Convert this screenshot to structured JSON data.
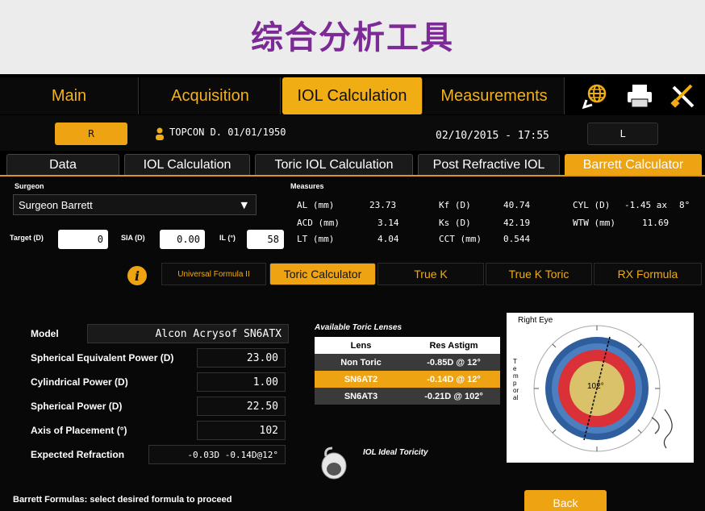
{
  "banner": {
    "title": "综合分析工具"
  },
  "main_tabs": [
    {
      "label": "Main"
    },
    {
      "label": "Acquisition"
    },
    {
      "label": "IOL Calculation"
    },
    {
      "label": "Measurements"
    }
  ],
  "icons": {
    "globe": "globe-icon",
    "printer": "printer-icon",
    "tools": "tools-icon"
  },
  "patient": {
    "right_eye": "R",
    "left_eye": "L",
    "name_dob": "TOPCON D. 01/01/1950",
    "datetime": "02/10/2015 - 17:55"
  },
  "sub_tabs": [
    {
      "label": "Data"
    },
    {
      "label": "IOL Calculation"
    },
    {
      "label": "Toric IOL Calculation"
    },
    {
      "label": "Post Refractive IOL"
    },
    {
      "label": "Barrett Calculator"
    }
  ],
  "surgeon": {
    "label": "Surgeon",
    "value": "Surgeon Barrett"
  },
  "inputs": {
    "target_label": "Target (D)",
    "target_value": "0",
    "sia_label": "SIA (D)",
    "sia_value": "0.00",
    "il_label": "IL (°)",
    "il_value": "58"
  },
  "measures": {
    "label": "Measures",
    "al_label": "AL (mm)",
    "al_value": "23.73",
    "acd_label": "ACD (mm)",
    "acd_value": "3.14",
    "lt_label": "LT (mm)",
    "lt_value": "4.04",
    "kf_label": "Kf (D)",
    "kf_value": "40.74",
    "ks_label": "Ks (D)",
    "ks_value": "42.19",
    "cct_label": "CCT (mm)",
    "cct_value": "0.544",
    "cyl_label": "CYL (D)",
    "cyl_value": "-1.45 ax",
    "cyl_axis": "8°",
    "wtw_label": "WTW (mm)",
    "wtw_value": "11.69"
  },
  "formula_tabs": [
    {
      "label": "Universal Formula II"
    },
    {
      "label": "Toric Calculator"
    },
    {
      "label": "True K"
    },
    {
      "label": "True K Toric"
    },
    {
      "label": "RX Formula"
    }
  ],
  "form": {
    "model_label": "Model",
    "model_value": "Alcon Acrysof SN6ATX",
    "seq_label": "Spherical Equivalent Power (D)",
    "seq_value": "23.00",
    "cyl_label": "Cylindrical Power (D)",
    "cyl_value": "1.00",
    "sph_label": "Spherical Power (D)",
    "sph_value": "22.50",
    "axis_label": "Axis of Placement (°)",
    "axis_value": "102",
    "exp_label": "Expected Refraction",
    "exp_value": "-0.03D  -0.14D@12°"
  },
  "toric_table": {
    "title": "Available Toric Lenses",
    "headers": [
      "Lens",
      "Res Astigm"
    ],
    "rows": [
      [
        "Non Toric",
        "-0.85D @ 12°"
      ],
      [
        "SN6AT2",
        "-0.14D @ 12°"
      ],
      [
        "SN6AT3",
        "-0.21D @ 102°"
      ]
    ]
  },
  "ideal_toricity": "IOL Ideal Toricity",
  "diagram": {
    "eye_label": "Right Eye",
    "axis_label": "102°",
    "temporal": "Temporal"
  },
  "footer": {
    "hint": "Barrett Formulas: select desired formula to proceed",
    "back": "Back"
  },
  "colors": {
    "accent": "#eea312",
    "banner_text": "#7b2a96",
    "tab_text": "#f2b21c"
  }
}
